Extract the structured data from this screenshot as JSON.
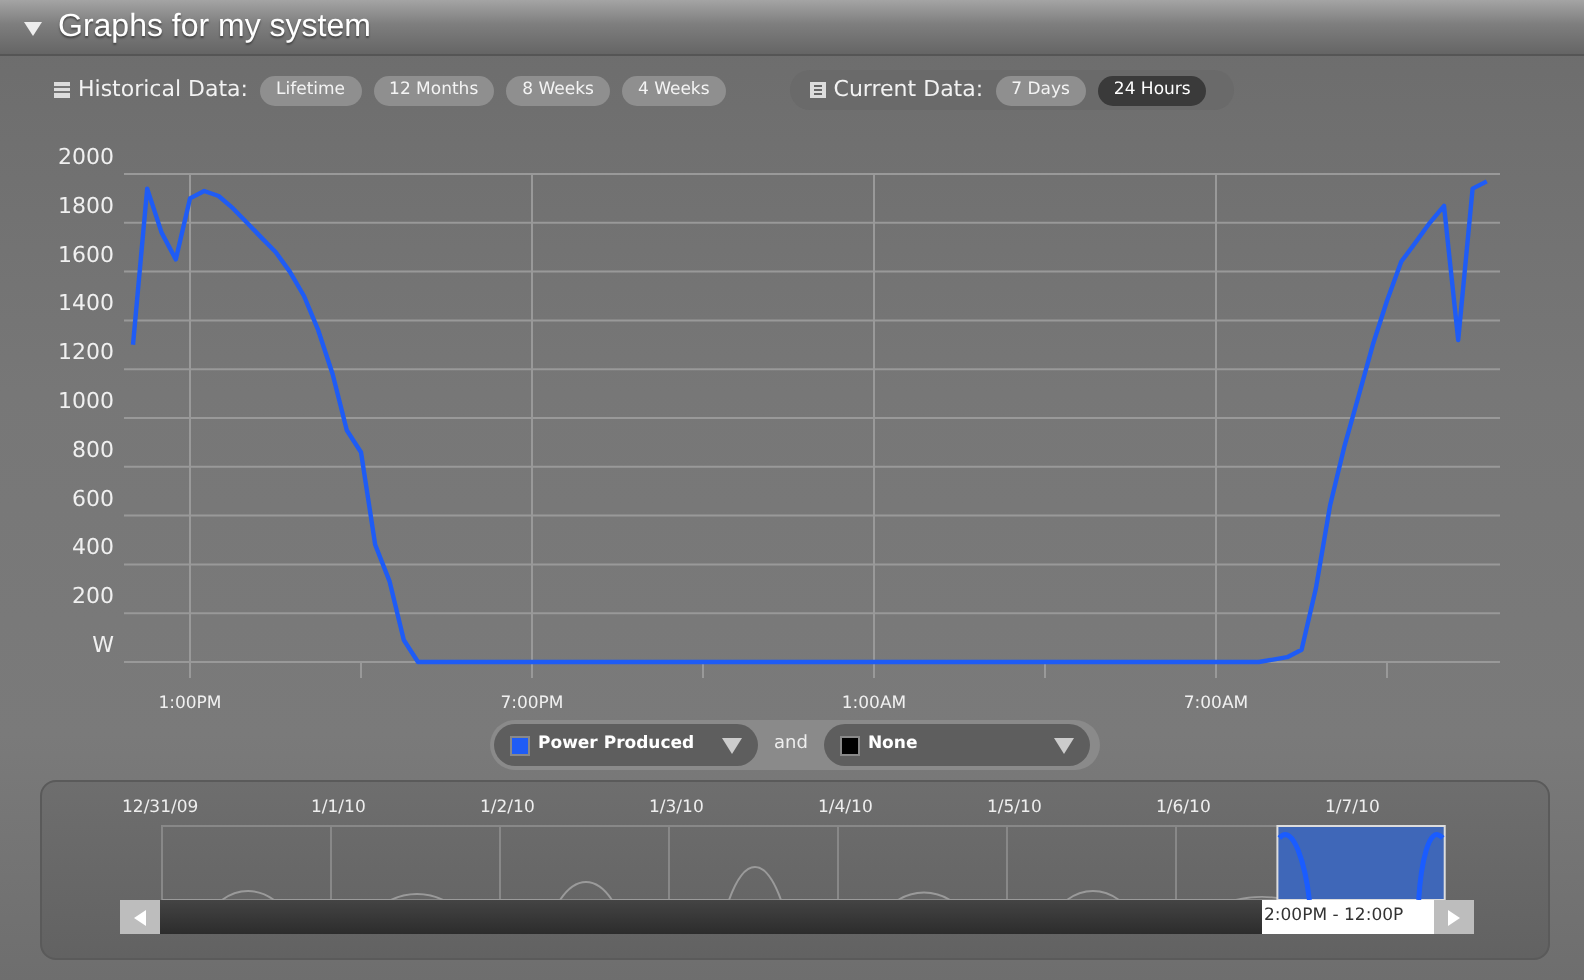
{
  "header": {
    "title": "Graphs for my system",
    "expanded": true
  },
  "historical": {
    "label": "Historical Data:",
    "buttons": [
      {
        "label": "Lifetime",
        "selected": false
      },
      {
        "label": "12 Months",
        "selected": false
      },
      {
        "label": "8 Weeks",
        "selected": false
      },
      {
        "label": "4 Weeks",
        "selected": false
      }
    ]
  },
  "current": {
    "label": "Current Data:",
    "buttons": [
      {
        "label": "7 Days",
        "selected": false
      },
      {
        "label": "24 Hours",
        "selected": true
      }
    ]
  },
  "chart": {
    "chart_data": {
      "type": "line",
      "categories": [
        null,
        null,
        null,
        null,
        "1:00PM",
        null,
        null,
        null,
        null,
        null,
        null,
        null,
        null,
        null,
        null,
        null,
        null,
        null,
        null,
        null,
        null,
        null,
        null,
        null,
        null,
        null,
        null,
        null,
        "7:00PM",
        null,
        null,
        null,
        null,
        null,
        null,
        null,
        null,
        null,
        null,
        null,
        null,
        null,
        null,
        null,
        null,
        null,
        null,
        null,
        null,
        null,
        null,
        null,
        "1:00AM",
        null,
        null,
        null,
        null,
        null,
        null,
        null,
        null,
        null,
        null,
        null,
        null,
        null,
        null,
        null,
        null,
        null,
        null,
        null,
        null,
        null,
        null,
        null,
        "7:00AM",
        null,
        null,
        null,
        null,
        null,
        null,
        null,
        null,
        null,
        null,
        null,
        null,
        null,
        null,
        null,
        null,
        null,
        null,
        null
      ],
      "series": [
        {
          "name": "Power Produced",
          "color": "#1f5cf5",
          "values": [
            1300,
            1940,
            1760,
            1650,
            1900,
            1930,
            1910,
            1860,
            1800,
            1740,
            1680,
            1600,
            1500,
            1360,
            1180,
            950,
            860,
            480,
            330,
            90,
            0,
            0,
            0,
            0,
            0,
            0,
            0,
            0,
            0,
            0,
            0,
            0,
            0,
            0,
            0,
            0,
            0,
            0,
            0,
            0,
            0,
            0,
            0,
            0,
            0,
            0,
            0,
            0,
            0,
            0,
            0,
            0,
            0,
            0,
            0,
            0,
            0,
            0,
            0,
            0,
            0,
            0,
            0,
            0,
            0,
            0,
            0,
            0,
            0,
            0,
            0,
            0,
            0,
            0,
            0,
            0,
            0,
            0,
            0,
            0,
            10,
            20,
            50,
            300,
            640,
            880,
            1090,
            1300,
            1480,
            1640,
            1720,
            1800,
            1870,
            1320,
            1940,
            1970
          ]
        }
      ],
      "ylim": [
        0,
        2000
      ],
      "grid": true,
      "yticks": [
        {
          "value": 0,
          "label": "W"
        },
        200,
        400,
        600,
        800,
        1000,
        1200,
        1400,
        1600,
        1800,
        2000
      ]
    }
  },
  "legend": {
    "items": [
      {
        "kind": "series"
      },
      {
        "kind": "plain",
        "label": "None",
        "color": "#000000"
      }
    ],
    "connector": "and"
  },
  "navigator": {
    "dates": [
      "12/31/09",
      "1/1/10",
      "1/2/10",
      "1/3/10",
      "1/4/10",
      "1/5/10",
      "1/6/10",
      "1/7/10"
    ],
    "range_label": "2:00PM - 12:00P"
  }
}
